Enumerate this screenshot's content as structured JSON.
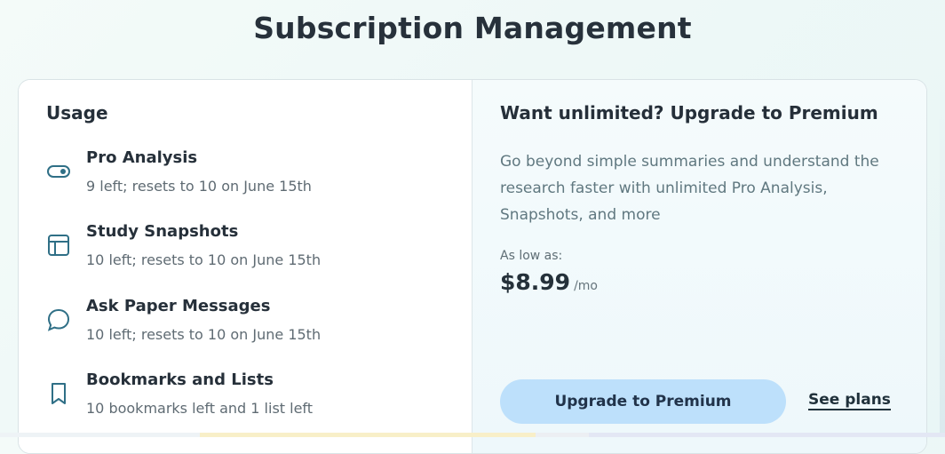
{
  "page": {
    "title": "Subscription Management"
  },
  "usage": {
    "heading": "Usage",
    "items": [
      {
        "icon": "toggle-icon",
        "name": "Pro Analysis",
        "status": "9 left; resets to 10 on June 15th"
      },
      {
        "icon": "table-icon",
        "name": "Study Snapshots",
        "status": "10 left; resets to 10 on June 15th"
      },
      {
        "icon": "chat-bubble-icon",
        "name": "Ask Paper Messages",
        "status": "10 left; resets to 10 on June 15th"
      },
      {
        "icon": "bookmark-icon",
        "name": "Bookmarks and Lists",
        "status": "10 bookmarks left and 1 list left"
      }
    ]
  },
  "premium": {
    "title": "Want unlimited? Upgrade to Premium",
    "description": "Go beyond simple summaries and understand the research faster with unlimited Pro Analysis, Snapshots, and more",
    "price_label": "As low as:",
    "price": "$8.99",
    "price_unit": "/mo",
    "upgrade_button": "Upgrade to Premium",
    "see_plans_link": "See plans"
  },
  "colors": {
    "accent_button": "#bde0fb",
    "icon_color": "#2f6f86",
    "background": "#eef8f7"
  }
}
